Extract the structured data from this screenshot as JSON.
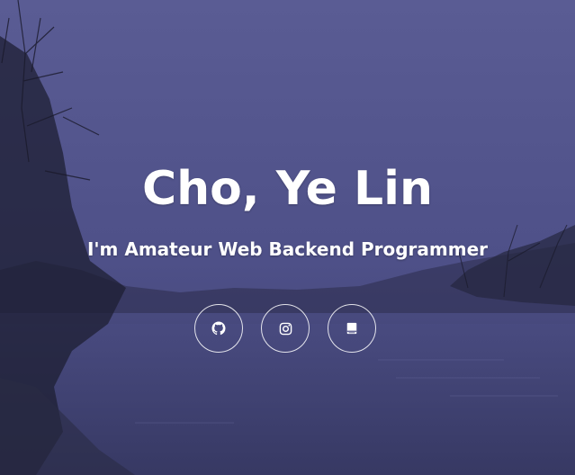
{
  "hero": {
    "title": "Cho, Ye Lin",
    "subtitle": "I'm Amateur Web Backend Programmer",
    "background_tint": "#4d4f85"
  },
  "social": {
    "links": [
      {
        "name": "github",
        "icon": "github-icon"
      },
      {
        "name": "instagram",
        "icon": "instagram-icon"
      },
      {
        "name": "blog",
        "icon": "notebook-icon"
      }
    ]
  }
}
